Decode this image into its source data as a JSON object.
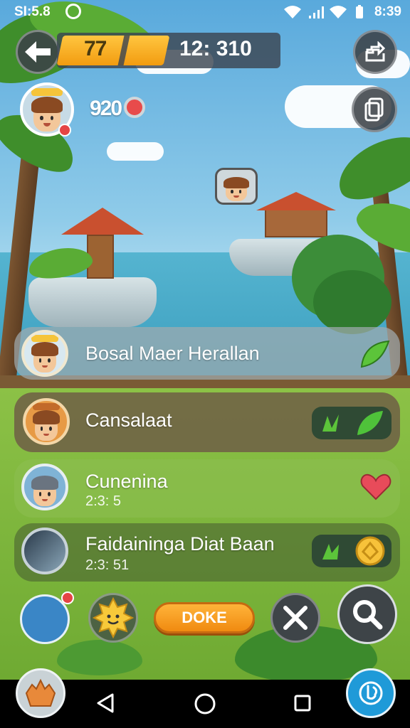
{
  "status_bar": {
    "left_text": "SI:5.8",
    "time": "8:39"
  },
  "hud": {
    "xp_value": "77",
    "score": "12: 310",
    "level": "920"
  },
  "list": [
    {
      "name": "Bosal Maer  Herallan",
      "sub": ""
    },
    {
      "name": "Cansalaat",
      "sub": ""
    },
    {
      "name": "Cunenina",
      "sub": "2:3: 5"
    },
    {
      "name": "Faidainingа Diat Baan",
      "sub": "2:3: 51"
    }
  ],
  "buttons": {
    "doke_label": "DOKE"
  },
  "icons": {
    "back": "back-arrow-icon",
    "share": "share-icon",
    "copy": "copy-icon",
    "compass": "compass-icon",
    "sun": "sun-icon",
    "close": "close-icon",
    "search": "search-icon",
    "leaf": "leaf-icon",
    "heart": "heart-icon",
    "coin": "coin-icon",
    "nav_back": "nav-back-icon",
    "nav_home": "nav-home-icon",
    "nav_recent": "nav-recent-icon"
  },
  "colors": {
    "accent": "#f29c10",
    "sky": "#59a9dc",
    "grass": "#7fb43a"
  }
}
